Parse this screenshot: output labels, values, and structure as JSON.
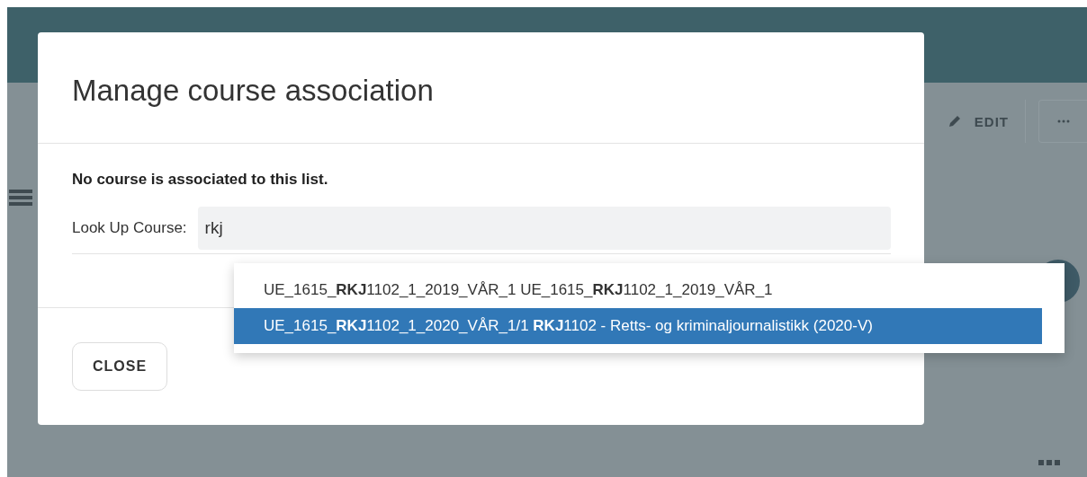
{
  "page": {
    "edit_button": "EDIT"
  },
  "modal": {
    "title": "Manage course association",
    "message": "No course is associated to this list.",
    "lookup": {
      "label": "Look Up Course:",
      "value": "rkj"
    },
    "suggestions": [
      {
        "text": "UE_1615_**RKJ**1102_1_2019_VÅR_1 UE_1615_**RKJ**1102_1_2019_VÅR_1",
        "selected": false
      },
      {
        "text": "UE_1615_**RKJ**1102_1_2020_VÅR_1/1 **RKJ**1102 - Retts- og kriminaljournalistikk (2020-V)",
        "selected": true
      }
    ],
    "close_button": "CLOSE"
  }
}
